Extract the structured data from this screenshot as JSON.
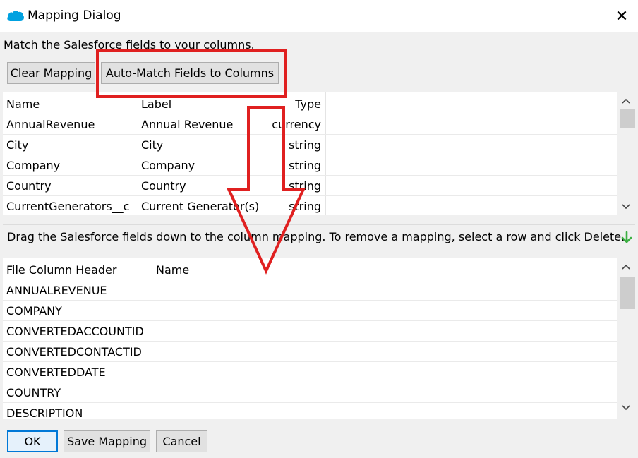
{
  "window": {
    "title": "Mapping Dialog",
    "close_label": "✕"
  },
  "instruction": "Match the Salesforce fields to your columns.",
  "toolbar": {
    "clear_label": "Clear Mapping",
    "automatch_label": "Auto-Match Fields to Columns"
  },
  "fields_table": {
    "columns": [
      "Name",
      "Label",
      "Type"
    ],
    "rows": [
      [
        "AnnualRevenue",
        "Annual Revenue",
        "currency"
      ],
      [
        "City",
        "City",
        "string"
      ],
      [
        "Company",
        "Company",
        "string"
      ],
      [
        "Country",
        "Country",
        "string"
      ],
      [
        "CurrentGenerators__c",
        "Current Generator(s)",
        "string"
      ]
    ]
  },
  "drag_hint": "Drag the Salesforce fields down to the column mapping.  To remove a mapping, select a row and click Delete.",
  "mapping_table": {
    "columns": [
      "File Column Header",
      "Name"
    ],
    "rows": [
      [
        "ANNUALREVENUE",
        ""
      ],
      [
        "COMPANY",
        ""
      ],
      [
        "CONVERTEDACCOUNTID",
        ""
      ],
      [
        "CONVERTEDCONTACTID",
        ""
      ],
      [
        "CONVERTEDDATE",
        ""
      ],
      [
        "COUNTRY",
        ""
      ],
      [
        "DESCRIPTION",
        ""
      ]
    ]
  },
  "footer": {
    "ok_label": "OK",
    "save_label": "Save Mapping",
    "cancel_label": "Cancel"
  },
  "icons": {
    "app": "salesforce-cloud-icon",
    "drag_hint": "green-down-arrow-icon",
    "close": "close-icon"
  },
  "colors": {
    "annotation": "#e02020",
    "accent": "#0078d7",
    "salesforce": "#00a1e0",
    "hint_arrow": "#3cb043"
  }
}
